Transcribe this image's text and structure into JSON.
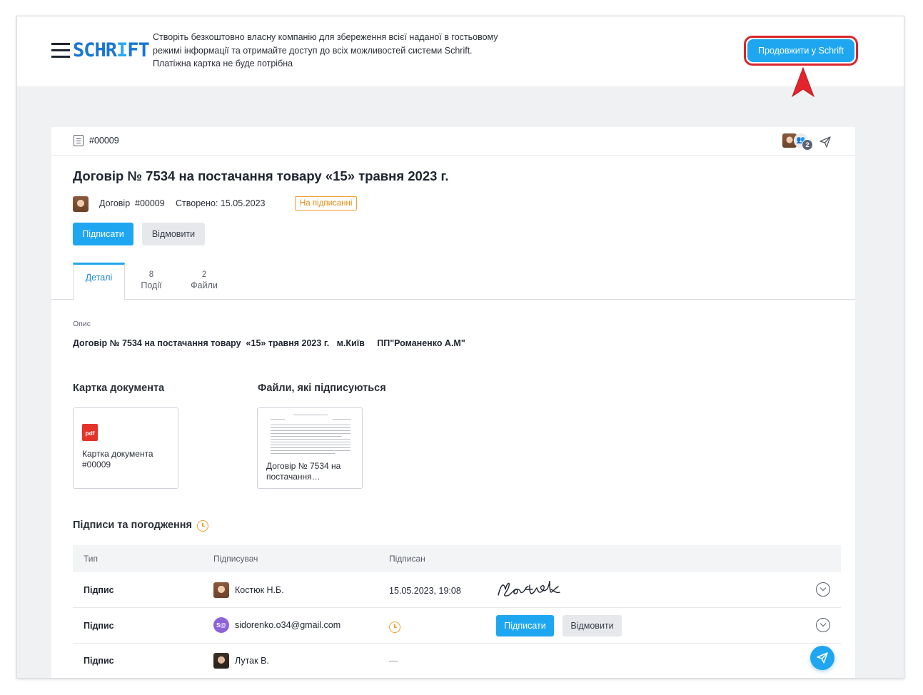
{
  "banner": {
    "logo_text": "SCHR",
    "logo_bar": "I",
    "logo_tail": "FT",
    "promo_lines": [
      "Створіть безкоштовно власну компанію для збереження всієї наданої в гостьовому",
      "режимі інформації та отримайте доступ до всіх можливостей системи Schrift.",
      "Платіжна картка не буде потрібна"
    ],
    "cta_label": "Продовжити у Schrift"
  },
  "document": {
    "number": "#00009",
    "participants_count": "2",
    "title": "Договір № 7534 на постачання товару «15» травня 2023 г.",
    "type": "Договір",
    "type_number": "#00009",
    "created": "Створено: 15.05.2023",
    "status": "На підписанні",
    "sign_label": "Підписати",
    "reject_label": "Відмовити"
  },
  "tabs": [
    {
      "count": "",
      "label": "Деталі",
      "active": true
    },
    {
      "count": "8",
      "label": "Події",
      "active": false
    },
    {
      "count": "2",
      "label": "Файли",
      "active": false
    }
  ],
  "details": {
    "description_label": "Опис",
    "description": "Договір № 7534 на постачання товару  «15» травня 2023 г.   м.Київ     ПП\"Романенко А.М\""
  },
  "cards": {
    "card_title": "Картка документа",
    "card_file_line1": "Картка документа",
    "card_file_line2": "#00009",
    "pdf_label": "pdf",
    "signed_title": "Файли, які підписуються",
    "signed_file_line1": "Договір № 7534 на",
    "signed_file_line2": "постачання…"
  },
  "signatures": {
    "title": "Підписи та погодження",
    "columns": [
      "Тип",
      "Підписувач",
      "Підписан"
    ],
    "rows": [
      {
        "type": "Підпис",
        "signer": "Костюк Н.Б.",
        "signed": "15.05.2023, 19:08",
        "signature": "Костюк"
      },
      {
        "type": "Підпис",
        "signer": "sidorenko.o34@gmail.com",
        "initials": "S@",
        "sign_label": "Підписати",
        "reject_label": "Відмовити"
      },
      {
        "type": "Підпис",
        "signer": "Лутак В.",
        "signed": "—"
      }
    ]
  },
  "colors": {
    "accent": "#1ea7f0",
    "status": "#f0a030",
    "highlight": "#d9252b"
  }
}
